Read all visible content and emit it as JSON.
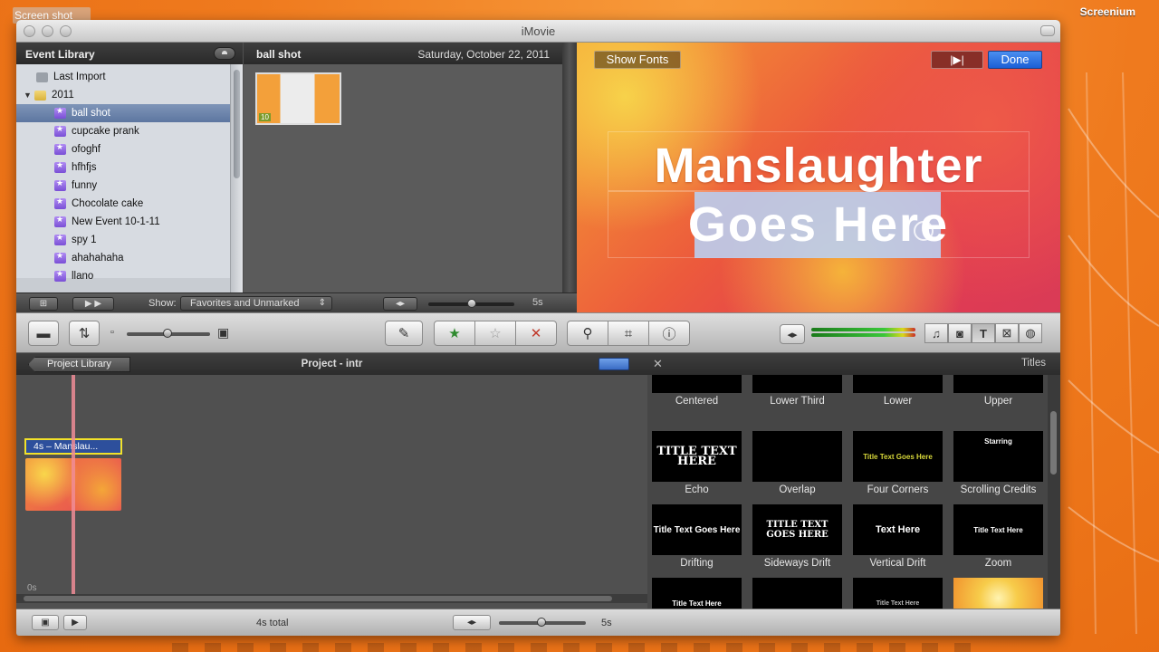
{
  "desktop": {
    "screenshot_label": "Screen shot",
    "recorder_label": "Screenium"
  },
  "window": {
    "title": "iMovie"
  },
  "event_library": {
    "header": "Event Library",
    "items": [
      {
        "label": "Last Import",
        "kind": "import"
      },
      {
        "label": "2011",
        "kind": "folder"
      },
      {
        "label": "ball shot",
        "kind": "event",
        "selected": true
      },
      {
        "label": "cupcake prank",
        "kind": "event"
      },
      {
        "label": "ofoghf",
        "kind": "event"
      },
      {
        "label": "hfhfjs",
        "kind": "event"
      },
      {
        "label": "funny",
        "kind": "event"
      },
      {
        "label": "Chocolate cake",
        "kind": "event"
      },
      {
        "label": "New Event 10-1-11",
        "kind": "event"
      },
      {
        "label": "spy 1",
        "kind": "event"
      },
      {
        "label": "ahahahaha",
        "kind": "event"
      },
      {
        "label": "llano",
        "kind": "event"
      }
    ]
  },
  "event_browser": {
    "event_name": "ball shot",
    "date": "Saturday, October 22, 2011",
    "clip_badge": "10"
  },
  "source_footer": {
    "show_label": "Show:",
    "show_value": "Favorites and Unmarked",
    "duration": "5s"
  },
  "viewer": {
    "show_fonts": "Show Fonts",
    "play_full": "|▶|",
    "done": "Done",
    "title_line1": "Manslaughter",
    "title_line2": "Goes Here"
  },
  "project": {
    "library_button": "Project Library",
    "title": "Project - intr",
    "clip_label": "4s – Manslau...",
    "time_start": "0s"
  },
  "titles": {
    "panel_label": "Titles",
    "items": [
      {
        "caption": "Centered",
        "thumb_text": ""
      },
      {
        "caption": "Lower Third",
        "thumb_text": ""
      },
      {
        "caption": "Lower",
        "thumb_text": ""
      },
      {
        "caption": "Upper",
        "thumb_text": ""
      },
      {
        "caption": "Echo",
        "thumb_text": "TITLE TEXT HERE"
      },
      {
        "caption": "Overlap",
        "thumb_text": ""
      },
      {
        "caption": "Four Corners",
        "thumb_text": "Title Text Goes Here"
      },
      {
        "caption": "Scrolling Credits",
        "thumb_text": "Starring"
      },
      {
        "caption": "Drifting",
        "thumb_text": "Title Text Goes Here"
      },
      {
        "caption": "Sideways Drift",
        "thumb_text": "TITLE TEXT GOES HERE"
      },
      {
        "caption": "Vertical Drift",
        "thumb_text": "Text Here"
      },
      {
        "caption": "Zoom",
        "thumb_text": "Title Text Here"
      },
      {
        "caption": "",
        "thumb_text": "Title Text Here"
      },
      {
        "caption": "",
        "thumb_text": ""
      },
      {
        "caption": "",
        "thumb_text": "Title Text Here"
      },
      {
        "caption": "",
        "thumb_text": ""
      }
    ]
  },
  "bottom_bar": {
    "total": "4s total",
    "duration": "5s"
  }
}
